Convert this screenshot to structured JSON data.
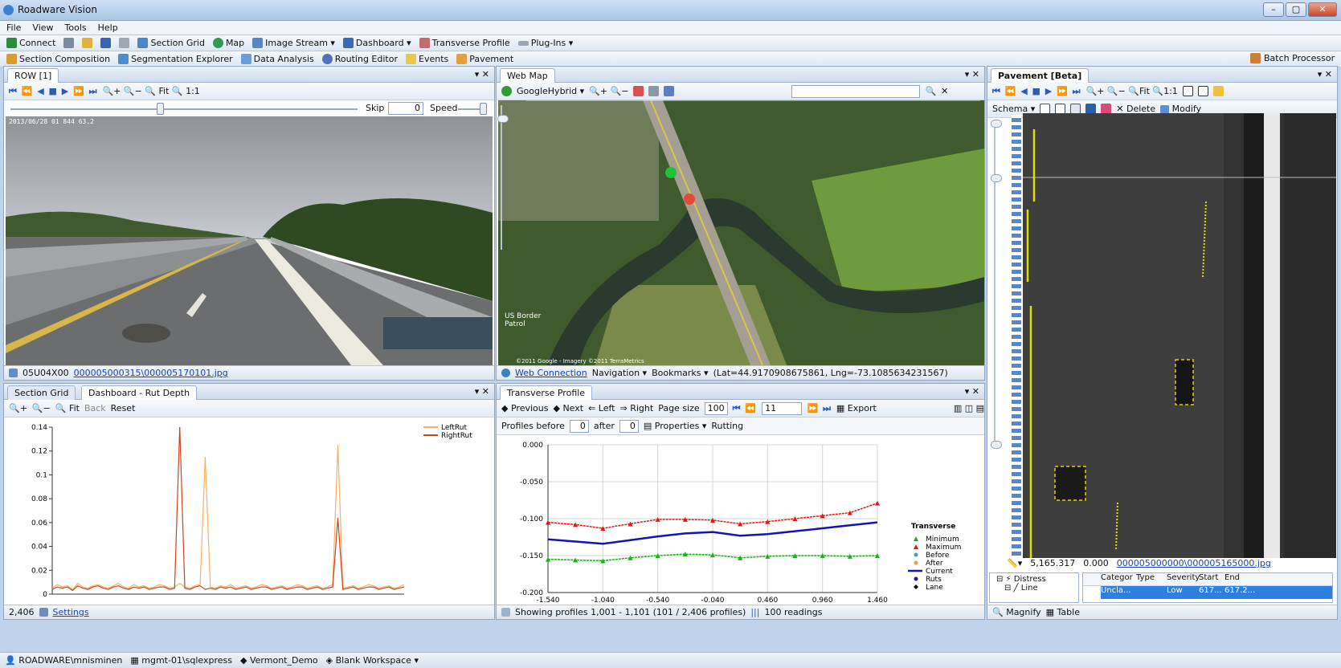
{
  "window": {
    "title": "Roadware Vision",
    "buttons": [
      "–",
      "▢",
      "✕"
    ]
  },
  "menu": [
    "File",
    "View",
    "Tools",
    "Help"
  ],
  "toolbar1": [
    "Connect",
    "Section Grid",
    "Map",
    "Image Stream ▾",
    "Dashboard ▾",
    "Transverse Profile",
    "Plug-Ins ▾"
  ],
  "toolbar2": [
    "Section Composition",
    "Segmentation Explorer",
    "Data Analysis",
    "Routing Editor",
    "Events",
    "Pavement"
  ],
  "batch_processor": "Batch Processor",
  "row_panel": {
    "tab": "ROW [1]",
    "nav": "⏮ ⏪ ◀ ■ ▶ ⏩ ⏭",
    "zoom": "🔍+ 🔍− 🔍 Fit 🔍 1:1",
    "skip_label": "Skip",
    "skip_value": "0",
    "speed_label": "Speed",
    "overlay": "2013/06/28          01 844                         63.2",
    "footer_code": "05U04X00",
    "footer_link": "000005000315\\000005170101.jpg"
  },
  "map_panel": {
    "tab": "Web Map",
    "provider": "GoogleHybrid ▾",
    "label_border": "US Border Patrol",
    "copyright": "©2011 Google - Imagery ©2011 TerraMetrics",
    "footer_link": "Web Connection",
    "footer_nav": "Navigation ▾",
    "footer_bookmarks": "Bookmarks ▾",
    "footer_coords": "(Lat=44.9170908675861, Lng=-73.1085634231567)"
  },
  "pavement_panel": {
    "tab": "Pavement [Beta]",
    "schema": "Schema ▾",
    "delete": "Delete",
    "modify": "Modify",
    "footer_pos": "5,165.317",
    "footer_zero": "0.000",
    "footer_link": "000005000000\\000005165000.jpg",
    "tree": [
      "Distress",
      "Line"
    ],
    "table_headers": [
      "Categor",
      "Type",
      "Severity",
      "Start",
      "End"
    ],
    "table_row": [
      "Uncla...",
      "",
      "Low",
      "617...",
      "617.2..."
    ],
    "tabs": [
      "Magnify",
      "Table"
    ]
  },
  "rut_panel": {
    "tabs": [
      "Section Grid",
      "Dashboard - Rut Depth"
    ],
    "toolbar": [
      "🔍+",
      "🔍−",
      "🔍 Fit",
      "Back",
      "Reset"
    ],
    "footer_count": "2,406",
    "footer_link": "Settings"
  },
  "profile_panel": {
    "tab": "Transverse Profile",
    "toolbar": [
      "Previous",
      "Next",
      "Left",
      "Right"
    ],
    "page_size_label": "Page size",
    "page_size": "100",
    "page_select": "11",
    "export": "Export",
    "profiles_before_label": "Profiles before",
    "before": "0",
    "after_label": "after",
    "after": "0",
    "properties": "Properties ▾",
    "rutting": "Rutting",
    "footer": "Showing profiles 1,001 - 1,101 (101 / 2,406 profiles)",
    "footer_readings": "100 readings"
  },
  "statusbar": [
    "ROADWARE\\mnisminen",
    "mgmt-01\\sqlexpress",
    "Vermont_Demo",
    "Blank Workspace ▾"
  ],
  "colors": {
    "left_rut": "#f5b060",
    "right_rut": "#c8451e",
    "minimum": "#1ab01a",
    "maximum": "#e01818",
    "current": "#1414b4"
  },
  "chart_data": [
    {
      "type": "line",
      "title": "",
      "xlabel": "",
      "ylabel": "",
      "ylim": [
        0,
        0.14
      ],
      "y_ticks": [
        "0",
        "0.02",
        "0.04",
        "0.06",
        "0.08",
        "0.1",
        "0.12",
        "0.14"
      ],
      "legend_position": "top-right",
      "series": [
        {
          "name": "LeftRut",
          "values": [
            0.005,
            0.008,
            0.006,
            0.007,
            0.004,
            0.009,
            0.006,
            0.005,
            0.007,
            0.008,
            0.006,
            0.005,
            0.007,
            0.009,
            0.006,
            0.005,
            0.008,
            0.006,
            0.007,
            0.005,
            0.006,
            0.008,
            0.007,
            0.005,
            0.006,
            0.009,
            0.006,
            0.005,
            0.007,
            0.008,
            0.115,
            0.006,
            0.005,
            0.007,
            0.006,
            0.008,
            0.005,
            0.006,
            0.007,
            0.005,
            0.006,
            0.008,
            0.007,
            0.005,
            0.006,
            0.007,
            0.005,
            0.006,
            0.008,
            0.007,
            0.005,
            0.006,
            0.007,
            0.005,
            0.006,
            0.008,
            0.125,
            0.005,
            0.006,
            0.007,
            0.005,
            0.006,
            0.008,
            0.007,
            0.005,
            0.006,
            0.007,
            0.005,
            0.006,
            0.008
          ]
        },
        {
          "name": "RightRut",
          "values": [
            0.004,
            0.006,
            0.005,
            0.006,
            0.003,
            0.007,
            0.005,
            0.004,
            0.006,
            0.007,
            0.005,
            0.004,
            0.006,
            0.007,
            0.005,
            0.004,
            0.006,
            0.005,
            0.006,
            0.004,
            0.005,
            0.006,
            0.006,
            0.004,
            0.005,
            0.14,
            0.005,
            0.004,
            0.006,
            0.007,
            0.004,
            0.005,
            0.004,
            0.006,
            0.005,
            0.006,
            0.004,
            0.005,
            0.006,
            0.004,
            0.005,
            0.006,
            0.006,
            0.004,
            0.005,
            0.006,
            0.004,
            0.005,
            0.006,
            0.006,
            0.004,
            0.005,
            0.006,
            0.004,
            0.005,
            0.006,
            0.064,
            0.004,
            0.005,
            0.006,
            0.004,
            0.005,
            0.006,
            0.006,
            0.004,
            0.005,
            0.006,
            0.004,
            0.005,
            0.006
          ]
        }
      ]
    },
    {
      "type": "line",
      "title": "",
      "xlabel": "",
      "ylabel": "",
      "xlim": [
        -1.54,
        1.46
      ],
      "ylim": [
        -0.2,
        0.0
      ],
      "x_ticks": [
        "-1.540",
        "-1.040",
        "-0.540",
        "-0.040",
        "0.460",
        "0.960",
        "1.460"
      ],
      "y_ticks": [
        "0.000",
        "-0.050",
        "-0.100",
        "-0.150",
        "-0.200"
      ],
      "legend_title": "Transverse",
      "legend_position": "right",
      "legend": [
        "Minimum",
        "Maximum",
        "Before",
        "After",
        "Current",
        "Ruts",
        "Lane"
      ],
      "x": [
        -1.54,
        -1.29,
        -1.04,
        -0.79,
        -0.54,
        -0.29,
        -0.04,
        0.21,
        0.46,
        0.71,
        0.96,
        1.21,
        1.46
      ],
      "series": [
        {
          "name": "Maximum",
          "values": [
            -0.105,
            -0.108,
            -0.113,
            -0.107,
            -0.101,
            -0.101,
            -0.102,
            -0.107,
            -0.104,
            -0.1,
            -0.096,
            -0.092,
            -0.079
          ]
        },
        {
          "name": "Current",
          "values": [
            -0.128,
            -0.131,
            -0.134,
            -0.129,
            -0.124,
            -0.12,
            -0.118,
            -0.123,
            -0.121,
            -0.117,
            -0.113,
            -0.109,
            -0.105
          ]
        },
        {
          "name": "Minimum",
          "values": [
            -0.155,
            -0.156,
            -0.157,
            -0.153,
            -0.15,
            -0.148,
            -0.149,
            -0.153,
            -0.151,
            -0.15,
            -0.15,
            -0.151,
            -0.15
          ]
        }
      ]
    }
  ]
}
